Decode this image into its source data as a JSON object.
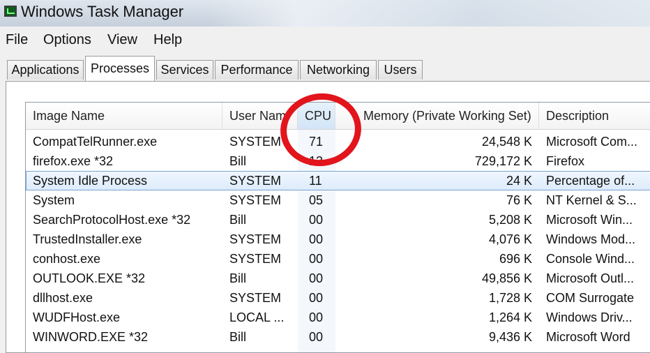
{
  "window": {
    "title": "Windows Task Manager"
  },
  "menu": [
    "File",
    "Options",
    "View",
    "Help"
  ],
  "tabs": [
    "Applications",
    "Processes",
    "Services",
    "Performance",
    "Networking",
    "Users"
  ],
  "active_tab": "Processes",
  "columns": {
    "image_name": "Image Name",
    "user_name": "User Nam",
    "cpu": "CPU",
    "memory": "Memory (Private Working Set)",
    "description": "Description"
  },
  "processes": [
    {
      "name": "CompatTelRunner.exe",
      "user": "SYSTEM",
      "cpu": "71",
      "memory": "24,548 K",
      "description": "Microsoft Com..."
    },
    {
      "name": "firefox.exe *32",
      "user": "Bill",
      "cpu": "13",
      "memory": "729,172 K",
      "description": "Firefox"
    },
    {
      "name": "System Idle Process",
      "user": "SYSTEM",
      "cpu": "11",
      "memory": "24 K",
      "description": "Percentage of..."
    },
    {
      "name": "System",
      "user": "SYSTEM",
      "cpu": "05",
      "memory": "76 K",
      "description": "NT Kernel & S..."
    },
    {
      "name": "SearchProtocolHost.exe *32",
      "user": "Bill",
      "cpu": "00",
      "memory": "5,208 K",
      "description": "Microsoft Win..."
    },
    {
      "name": "TrustedInstaller.exe",
      "user": "SYSTEM",
      "cpu": "00",
      "memory": "4,076 K",
      "description": "Windows Mod..."
    },
    {
      "name": "conhost.exe",
      "user": "SYSTEM",
      "cpu": "00",
      "memory": "696 K",
      "description": "Console Wind..."
    },
    {
      "name": "OUTLOOK.EXE *32",
      "user": "Bill",
      "cpu": "00",
      "memory": "49,856 K",
      "description": "Microsoft Outl..."
    },
    {
      "name": "dllhost.exe",
      "user": "SYSTEM",
      "cpu": "00",
      "memory": "1,728 K",
      "description": "COM Surrogate"
    },
    {
      "name": "WUDFHost.exe",
      "user": "LOCAL ...",
      "cpu": "00",
      "memory": "1,264 K",
      "description": "Windows Driv..."
    },
    {
      "name": "WINWORD.EXE *32",
      "user": "Bill",
      "cpu": "00",
      "memory": "9,436 K",
      "description": "Microsoft Word"
    }
  ],
  "selected_row": 2,
  "annotation": {
    "color": "#e2141c"
  }
}
